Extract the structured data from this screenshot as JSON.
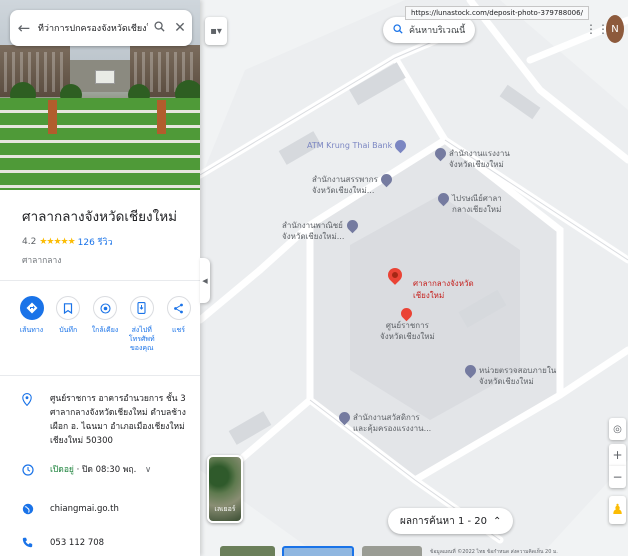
{
  "search": {
    "value": "ที่ว่าการปกครองจังหวัดเชียงใหม่"
  },
  "place": {
    "name": "ศาลากลางจังหวัดเชียงใหม่",
    "rating": "4.2",
    "stars": "★★★★★",
    "reviews": "126 รีวิว",
    "category": "ศาลากลาง"
  },
  "actions": [
    {
      "label": "เส้นทาง"
    },
    {
      "label": "บันทึก"
    },
    {
      "label": "ใกล้เคียง"
    },
    {
      "label": "ส่งไปที่โทรศัพท์ของคุณ"
    },
    {
      "label": "แชร์"
    }
  ],
  "info": {
    "address": "ศูนย์ราชการ อาคารอำนวยการ ชั้น 3 ศาลากลางจังหวัดเชียงใหม่ ตำบลช้างเผือก อ. ไฉนมา อำเภอเมืองเชียงใหม่ เชียงใหม่ 50300",
    "hours_status": "เปิดอยู่",
    "hours_detail": " · ปิด 08:30 พฤ.",
    "website": "chiangmai.go.th",
    "phone": "053 112 708"
  },
  "map": {
    "url_tooltip": "https://lunastock.com/deposit-photo-379788006/",
    "search_area_label": "ค้นหาบริเวณนี้",
    "avatar_letter": "N",
    "layers_label": "เลเยอร์",
    "results_label": "ผลการค้นหา 1 - 20",
    "attribution": "ข้อมูลแผนที่ ©2022   ไทย   ข้อกำหนด   ส่งความคิดเห็น   20 ม.",
    "main_label_line1": "ศาลากลางจังหวัด",
    "main_label_line2": "เชียงใหม่",
    "sub_label_line1": "ศูนย์ราชการ",
    "sub_label_line2": "จังหวัดเชียงใหม่",
    "pois": [
      {
        "line1": "ATM Krung Thai Bank",
        "line2": ""
      },
      {
        "line1": "สำนักงานสรรพากร",
        "line2": "จังหวัดเชียงใหม่..."
      },
      {
        "line1": "สำนักงานแรงงาน",
        "line2": "จังหวัดเชียงใหม่"
      },
      {
        "line1": "ไปรษณีย์ศาลา",
        "line2": "กลางเชียงใหม่"
      },
      {
        "line1": "สำนักงานพาณิชย์",
        "line2": "จังหวัดเชียงใหม่..."
      },
      {
        "line1": "หน่วยตรวจสอบภายใน",
        "line2": "จังหวัดเชียงใหม่"
      },
      {
        "line1": "สำนักงานสวัสดิการ",
        "line2": "และคุ้มครองแรงงาน..."
      }
    ]
  }
}
